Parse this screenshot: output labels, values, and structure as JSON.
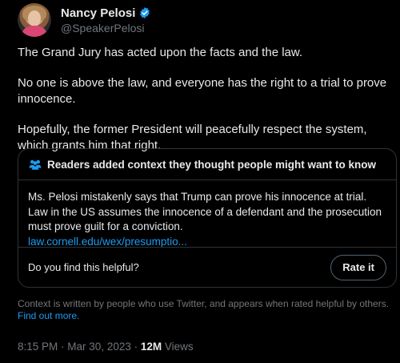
{
  "user": {
    "display_name": "Nancy Pelosi",
    "handle": "@SpeakerPelosi",
    "verified": true
  },
  "tweet": {
    "paragraphs": [
      "The Grand Jury has acted upon the facts and the law.",
      "No one is above the law, and everyone has the right to a trial to prove innocence.",
      "Hopefully, the former President will peacefully respect the system, which grants him that right."
    ]
  },
  "community_note": {
    "title": "Readers added context they thought people might want to know",
    "body": "Ms. Pelosi mistakenly says that Trump can prove his innocence at trial. Law in the US assumes the innocence of a defendant and the prosecution must prove guilt for a conviction.",
    "link_text": "law.cornell.edu/wex/presumptio...",
    "helpful_question": "Do you find this helpful?",
    "rate_button": "Rate it"
  },
  "context_footer": {
    "text": "Context is written by people who use Twitter, and appears when rated helpful by others.",
    "link": "Find out more."
  },
  "meta": {
    "time": "8:15 PM",
    "date": "Mar 30, 2023",
    "views_count": "12M",
    "views_label": "Views"
  },
  "colors": {
    "background": "#000000",
    "text": "#e7e9ea",
    "secondary": "#71767b",
    "accent": "#1d9bf0",
    "border": "#2f3336"
  },
  "icons": {
    "verified": "verified-badge-icon",
    "note_header": "people-icon"
  }
}
